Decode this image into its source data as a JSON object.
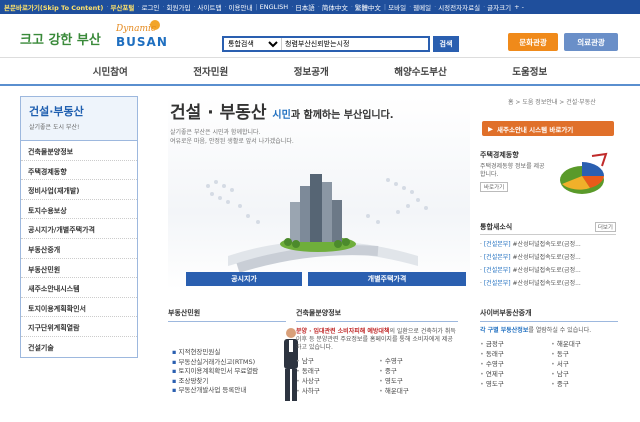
{
  "topbar": {
    "skip": "본문바로가기(Skip To Content)",
    "portal": "부산포털",
    "links": [
      "로그인",
      "회원가입",
      "사이트맵",
      "이용안내",
      "ENGLISH",
      "日本語",
      "简体中文",
      "繁體中文",
      "모바일",
      "웹메일",
      "시정전자자료실",
      "글자크기"
    ],
    "zoom": "+ -"
  },
  "header": {
    "logo_text": "크고 강한 부산",
    "logo_dynamic": "Dynamic",
    "logo_busan": "BUSAN",
    "search_select": "통합검색",
    "search_value": "청렴부산신뢰받는시정",
    "search_button": "검색",
    "btn_culture": "문화관광",
    "btn_medical": "의료관광"
  },
  "gnb": [
    "시민참여",
    "전자민원",
    "정보공개",
    "해양수도부산",
    "도움정보"
  ],
  "sidebar": {
    "title": "건설·부동산",
    "subtitle": "살기좋은 도시 부산!",
    "items": [
      "건축물분양정보",
      "주택경제동향",
      "정비사업(재개발)",
      "토지수용보상",
      "공시지가/개별주택가격",
      "부동산중개",
      "부동산민원",
      "새주소안내시스템",
      "토지이용계획확인서",
      "지구단위계획열람",
      "건설기술"
    ]
  },
  "hero": {
    "title": "건설 · 부동산",
    "title_blue": "시민",
    "title_rest": "과 함께하는 부산입니다.",
    "sub1": "살기좋은 부산은 시민과 함께합니다.",
    "sub2": "여유로운 마음, 안정된 생활로 앞서 나가겠습니다.",
    "btn1": "공시지가",
    "btn2": "개별주택가격"
  },
  "right": {
    "breadcrumb": "홈 > 도움 정보안내 > 건설·부동산",
    "sys_button": "새주소안내 시스템 바로가기",
    "stat_title": "주택경제동향",
    "stat_desc": "주택경제동향 정보를 제공합니다.",
    "stat_more": "바로가기",
    "news_title": "통합새소식",
    "news_more": "더보기",
    "news_items": [
      {
        "tag": "[건설본부]",
        "text": "#산성터널접속도로(금정..."
      },
      {
        "tag": "[건설본부]",
        "text": "#산성터널접속도로(금정..."
      },
      {
        "tag": "[건설본부]",
        "text": "#산성터널접속도로(금정..."
      },
      {
        "tag": "[건설본부]",
        "text": "#산성터널접속도로(금정..."
      }
    ]
  },
  "panels": {
    "p1_title": "부동산민원",
    "p1_items": [
      "지적현장민원실",
      "부동산실거래가신고(RTMS)",
      "토지이용계획확인서 무료열람",
      "조상땅찾기",
      "부동산개발사업 등록안내"
    ],
    "p2_title": "건축물분양정보",
    "p2_notice_red": "분양 · 임대관련 소비자피해 예방대책",
    "p2_notice": "의 일환으로 건축허가 취득이후 등 분양관련 주요정보를 홈페이지를 통해 소비자에게 제공하고 있습니다.",
    "p2_districts": [
      "남구",
      "수영구",
      "동래구",
      "중구",
      "사상구",
      "영도구",
      "사하구",
      "해운대구"
    ],
    "p3_title": "사이버부동산중개",
    "p3_desc_blue": "각 구별 부동산정보",
    "p3_desc": "를 열람하실 수 있습니다.",
    "p3_districts": [
      "금정구",
      "해운대구",
      "동래구",
      "동구",
      "수영구",
      "서구",
      "연제구",
      "남구",
      "영도구",
      "중구"
    ]
  },
  "colors": {
    "brand_blue": "#1f4f9c",
    "accent_orange": "#e0702a",
    "link_blue": "#1f6fc0"
  }
}
